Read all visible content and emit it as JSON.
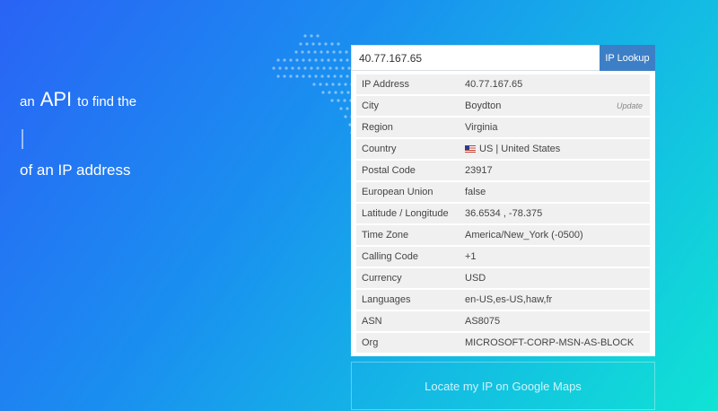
{
  "hero": {
    "prefix": "an",
    "highlight": "API",
    "suffix": "to find the",
    "line2": "of an IP address"
  },
  "search": {
    "value": "40.77.167.65",
    "button_label": "IP Lookup"
  },
  "results": [
    {
      "label": "IP Address",
      "value": "40.77.167.65"
    },
    {
      "label": "City",
      "value": "Boydton",
      "action": "Update"
    },
    {
      "label": "Region",
      "value": "Virginia"
    },
    {
      "label": "Country",
      "value": "US | United States",
      "flag": "us-flag-icon"
    },
    {
      "label": "Postal Code",
      "value": "23917"
    },
    {
      "label": "European Union",
      "value": "false"
    },
    {
      "label": "Latitude / Longitude",
      "value": "36.6534 , -78.375"
    },
    {
      "label": "Time Zone",
      "value": "America/New_York (-0500)"
    },
    {
      "label": "Calling Code",
      "value": "+1"
    },
    {
      "label": "Currency",
      "value": "USD"
    },
    {
      "label": "Languages",
      "value": "en-US,es-US,haw,fr"
    },
    {
      "label": "ASN",
      "value": "AS8075"
    },
    {
      "label": "Org",
      "value": "MICROSOFT-CORP-MSN-AS-BLOCK"
    }
  ],
  "maps_button": "Locate my IP on Google Maps"
}
